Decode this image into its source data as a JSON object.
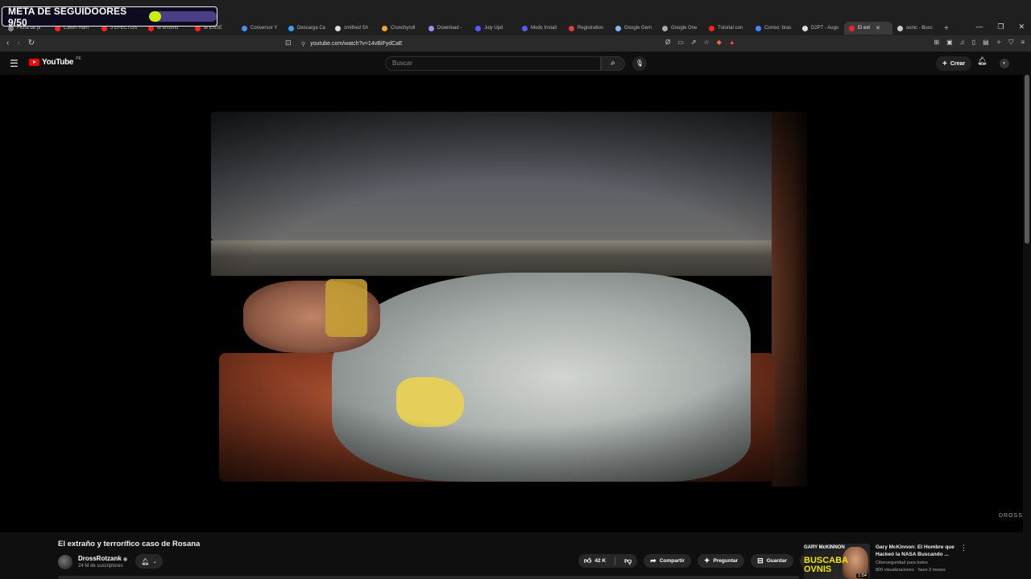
{
  "overlay": {
    "goal_text": "META DE SEGUIDOORES 9/50",
    "progress_fraction": 0.18,
    "fill_color": "#c9f000",
    "track_color": "#4a3e86"
  },
  "browser": {
    "tabs": [
      {
        "label": "Ficha de pi",
        "fav_color": "#888888",
        "active": false
      },
      {
        "label": "Calvin Harri",
        "fav_color": "#ff2020",
        "active": false
      },
      {
        "label": "3 EFECTOS",
        "fav_color": "#ff2020",
        "active": false
      },
      {
        "label": "te enseño",
        "fav_color": "#ff2020",
        "active": false
      },
      {
        "label": "te ENSE",
        "fav_color": "#ff2020",
        "active": false
      },
      {
        "label": "Conversor Y",
        "fav_color": "#4a8cff",
        "active": false
      },
      {
        "label": "Descarga Ca",
        "fav_color": "#3aa0ff",
        "active": false
      },
      {
        "label": "zmithed Sh",
        "fav_color": "#dddddd",
        "active": false
      },
      {
        "label": "Crunchyroll",
        "fav_color": "#f5a623",
        "active": false
      },
      {
        "label": "Download -",
        "fav_color": "#9b8cff",
        "active": false
      },
      {
        "label": "July Upd",
        "fav_color": "#5a5aff",
        "active": false
      },
      {
        "label": "Mods Install",
        "fav_color": "#5a5aff",
        "active": false
      },
      {
        "label": "Registration",
        "fav_color": "#e04040",
        "active": false
      },
      {
        "label": "Google Gem",
        "fav_color": "#8ab4f8",
        "active": false
      },
      {
        "label": "Google One",
        "fav_color": "#aaaaaa",
        "active": false
      },
      {
        "label": "Tutorial con",
        "fav_color": "#ff2020",
        "active": false
      },
      {
        "label": "Correo: bras",
        "fav_color": "#3a8cff",
        "active": false
      },
      {
        "label": "D2PT - Augu",
        "fav_color": "#dddddd",
        "active": false
      },
      {
        "label": "El ext",
        "fav_color": "#ff2020",
        "active": true
      },
      {
        "label": "sonic - Busc",
        "fav_color": "#cccccc",
        "active": false
      }
    ],
    "url": "youtube.com/watch?v=14vBiFydCaE"
  },
  "youtube": {
    "logo_text": "YouTube",
    "country_code": "PE",
    "search_placeholder": "Buscar",
    "create_label": "Crear"
  },
  "video": {
    "title": "El extraño y terrorífico caso de Rosana",
    "channel": "DrossRotzank",
    "verified_mark": "◉",
    "subscribers": "24 M de suscriptores",
    "likes": "42 K",
    "share_label": "Compartir",
    "ask_label": "Preguntar",
    "save_label": "Guardar",
    "watermark": "DROSS"
  },
  "recommended": {
    "thumb_top_text": "GARY McKINNON",
    "thumb_big_text": "BUSCABA OVNIS",
    "duration": "1:54",
    "title": "Gary McKinnon: El Hombre que Hackeó la NASA Buscando ...",
    "channel": "Ciberseguridad para todos",
    "meta": "800 visualizaciones · hace 3 meses"
  }
}
